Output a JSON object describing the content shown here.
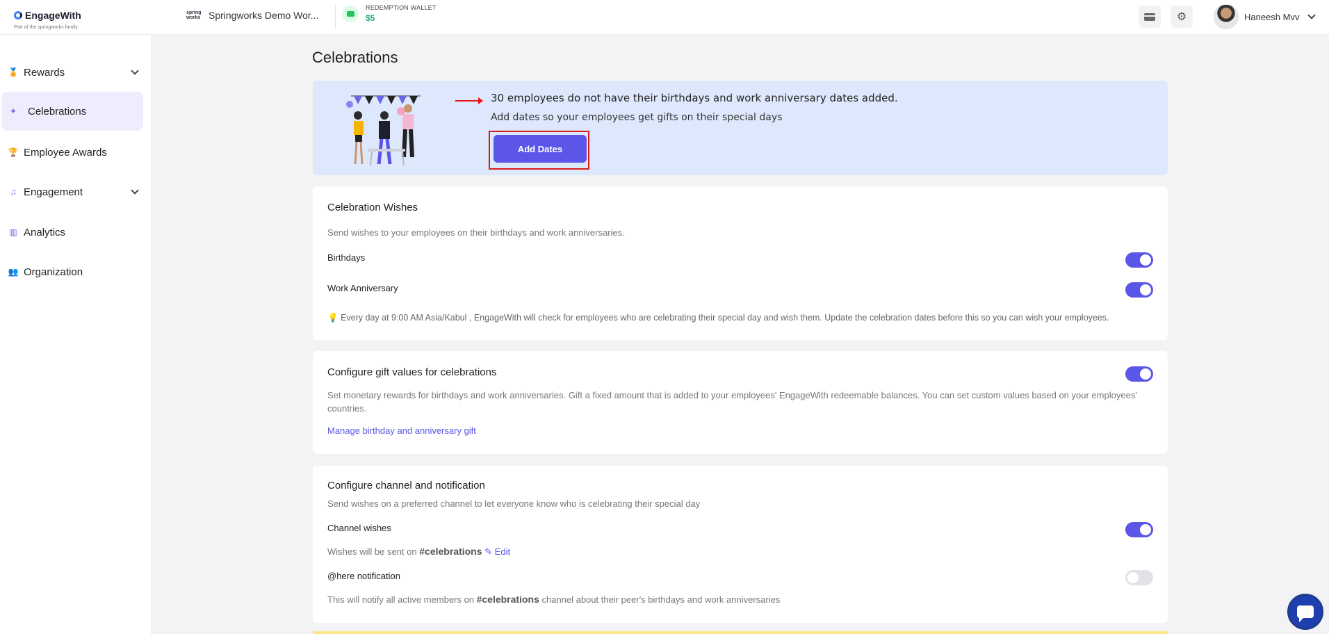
{
  "header": {
    "brand": "EngageWith",
    "brand_tag": "Part of the springworks family",
    "workspace_logo": "spring works",
    "workspace_name": "Springworks Demo Wor...",
    "wallet_label": "REDEMPTION WALLET",
    "wallet_amount": "$5",
    "user_name": "Haneesh Mvv"
  },
  "sidebar": {
    "items": [
      {
        "label": "Rewards",
        "icon": "medal-icon"
      },
      {
        "label": "Celebrations",
        "icon": "party-popper-icon"
      },
      {
        "label": "Employee Awards",
        "icon": "trophy-icon"
      },
      {
        "label": "Engagement",
        "icon": "engagement-icon"
      },
      {
        "label": "Analytics",
        "icon": "bar-chart-icon"
      },
      {
        "label": "Organization",
        "icon": "people-icon"
      }
    ]
  },
  "main": {
    "title": "Celebrations",
    "banner": {
      "title": "30 employees do not have their birthdays and work anniversary dates added.",
      "subtitle": "Add dates so your employees get gifts on their special days",
      "button": "Add Dates"
    },
    "wishes": {
      "title": "Celebration Wishes",
      "desc": "Send wishes to your employees on their birthdays and work anniversaries.",
      "birthdays_label": "Birthdays",
      "birthdays_on": true,
      "anniversary_label": "Work Anniversary",
      "anniversary_on": true,
      "note": "Every day at 9:00 AM Asia/Kabul , EngageWith will check for employees who are celebrating their special day and wish them. Update the celebration dates before this so you can wish your employees."
    },
    "gifts": {
      "title": "Configure gift values for celebrations",
      "enabled": true,
      "desc": "Set monetary rewards for birthdays and work anniversaries. Gift a fixed amount that is added to your employees' EngageWith redeemable balances. You can set custom values based on your employees' countries.",
      "link": "Manage birthday and anniversary gift"
    },
    "channel": {
      "title": "Configure channel and notification",
      "desc": "Send wishes on a preferred channel to let everyone know who is celebrating their special day",
      "channel_wishes_label": "Channel wishes",
      "channel_wishes_on": true,
      "sent_on_prefix": "Wishes will be sent on",
      "channel_name": "#celebrations",
      "edit_label": "Edit",
      "here_label": "@here notification",
      "here_on": false,
      "here_desc_prefix": "This will notify all active members on",
      "here_desc_suffix": "channel about their peer's birthdays and work anniversaries"
    }
  },
  "colors": {
    "accent": "#5b55e8",
    "banner_bg": "#dde8fc",
    "wallet_green": "#22b07d",
    "highlight_red": "#d71a1a"
  }
}
